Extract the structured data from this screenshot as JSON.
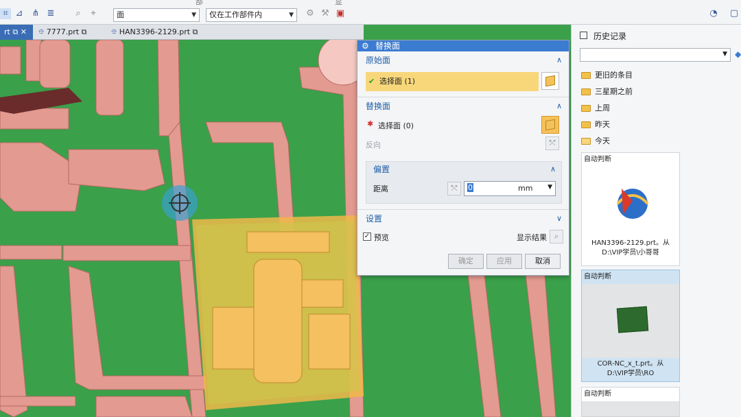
{
  "toolbar": {
    "filter_value": "面",
    "scope_value": "仅在工作部件内",
    "cut_labels": [
      "部",
      "显"
    ]
  },
  "tabs": [
    {
      "label": "rt",
      "active": true
    },
    {
      "label": "7777.prt",
      "active": false
    },
    {
      "label": "HAN3396-2129.prt",
      "active": false
    }
  ],
  "dialog": {
    "title": "替换面",
    "original_face": {
      "header": "原始面",
      "select_label": "选择面 (1)"
    },
    "replace_face": {
      "header": "替换面",
      "select_label": "选择面 (0)",
      "reverse_label": "反向"
    },
    "offset": {
      "header": "偏置",
      "distance_label": "距离",
      "distance_value": "0",
      "unit": "mm"
    },
    "settings": {
      "header": "设置",
      "preview_label": "预览",
      "preview_checked": true,
      "show_result_label": "显示结果"
    },
    "buttons": {
      "ok": "确定",
      "apply": "应用",
      "cancel": "取消"
    }
  },
  "history": {
    "title": "历史记录",
    "groups": [
      "更旧的条目",
      "三星期之前",
      "上周",
      "昨天",
      "今天"
    ],
    "cards": [
      {
        "tag": "自动判断",
        "caption_line1": "HAN3396-2129.prt。从",
        "caption_line2": "D:\\VIP学员\\小哥哥"
      },
      {
        "tag": "自动判断",
        "caption_line1": "COR-NC_x_t.prt。从",
        "caption_line2": "D:\\VIP学员\\RO"
      },
      {
        "tag": "自动判断"
      }
    ]
  },
  "colors": {
    "accent": "#3b7bd0",
    "selection": "#f7d77a",
    "model_green": "#3aa04a",
    "rib_pink": "#e8a49a",
    "highlight_orange": "#f0b84a"
  }
}
